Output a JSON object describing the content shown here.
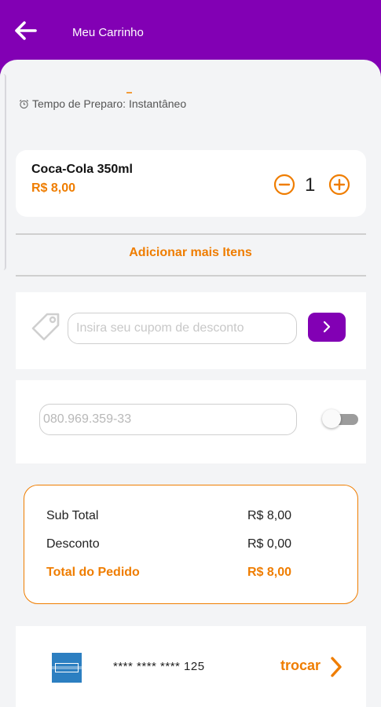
{
  "header": {
    "title": "Meu Carrinho"
  },
  "prep": {
    "text": "Tempo de Preparo: Instantâneo"
  },
  "cart": {
    "items": [
      {
        "name": "Coca-Cola 350ml",
        "price": "R$ 8,00",
        "quantity": "1"
      }
    ],
    "add_more_label": "Adicionar mais Itens"
  },
  "coupon": {
    "placeholder": "Insira seu cupom de desconto"
  },
  "cpf": {
    "value": "080.969.359-33",
    "toggle_on": false
  },
  "summary": {
    "subtotal_label": "Sub Total",
    "subtotal_value": "R$ 8,00",
    "discount_label": "Desconto",
    "discount_value": "R$ 0,00",
    "total_label": "Total do Pedido",
    "total_value": "R$ 8,00"
  },
  "payment": {
    "card_brand_icon": "amex-card-icon",
    "card_number": "**** **** **** 125",
    "swap_label": "trocar"
  },
  "colors": {
    "brand_purple": "#8200b4",
    "accent_orange": "#ef7d00",
    "background": "#f3f4f6"
  }
}
